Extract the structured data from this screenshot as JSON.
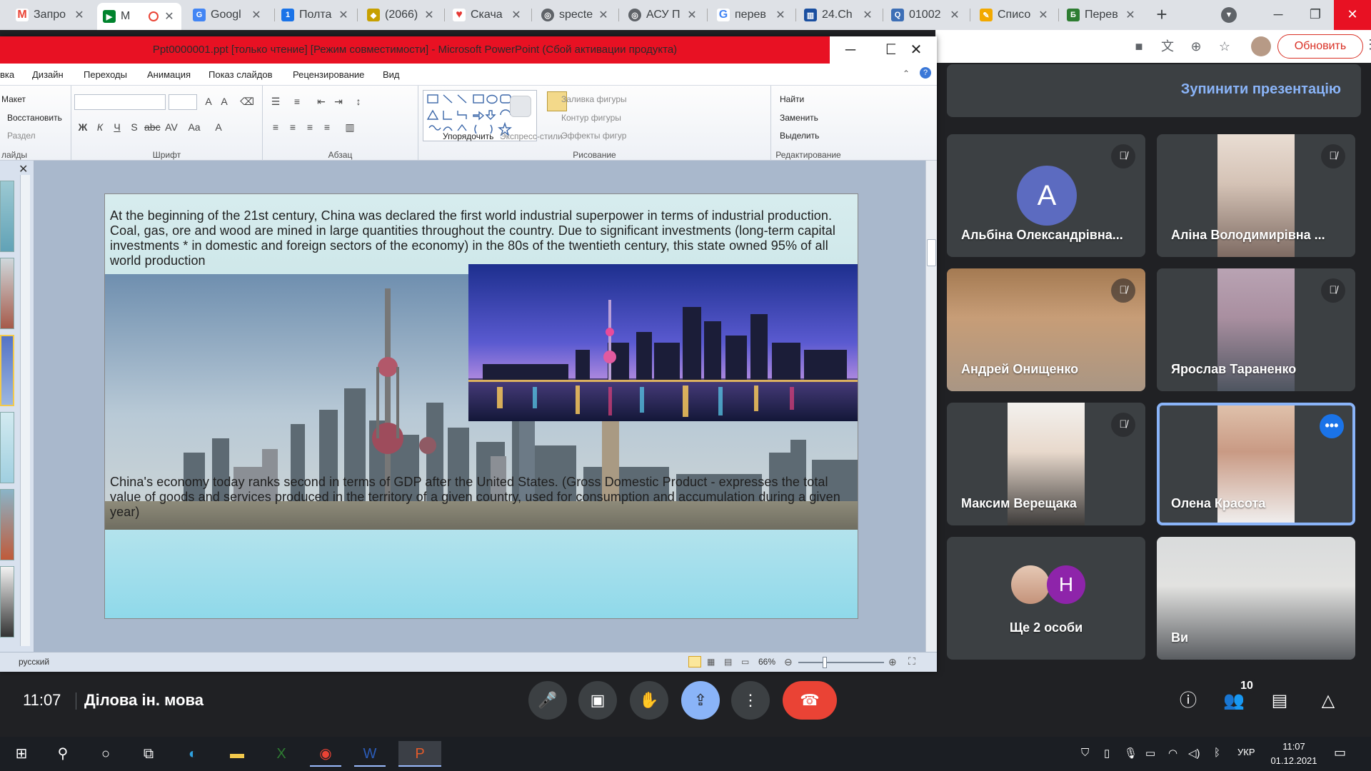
{
  "browser": {
    "tabs": [
      {
        "title": "Запро",
        "icon": "gmail-icon",
        "color": "#ea4335",
        "letter": "M"
      },
      {
        "title": "М",
        "icon": "meet-icon",
        "color": "#00832d",
        "letter": "▶"
      },
      {
        "title": "Googl",
        "icon": "google-translate-icon",
        "color": "#4285f4",
        "letter": "G"
      },
      {
        "title": "Полта",
        "icon": "calendar-icon",
        "color": "#1a73e8",
        "letter": "1"
      },
      {
        "title": "(2066)",
        "icon": "shop-icon",
        "color": "#c7a000",
        "letter": "◆"
      },
      {
        "title": "Скача",
        "icon": "heart-icon",
        "color": "#e53935",
        "letter": "♥"
      },
      {
        "title": "specte",
        "icon": "globe-icon",
        "color": "#5f6368",
        "letter": "◎"
      },
      {
        "title": "АСУ П",
        "icon": "globe-icon",
        "color": "#5f6368",
        "letter": "◎"
      },
      {
        "title": "перев",
        "icon": "google-icon",
        "color": "#4285f4",
        "letter": "G"
      },
      {
        "title": "24.Ch",
        "icon": "bank-icon",
        "color": "#1a4fa0",
        "letter": "▥"
      },
      {
        "title": "01002",
        "icon": "search-doc-icon",
        "color": "#3d6fb6",
        "letter": "Q"
      },
      {
        "title": "Списо",
        "icon": "pencil-icon",
        "color": "#f2a900",
        "letter": "✎"
      },
      {
        "title": "Перев",
        "icon": "b-icon",
        "color": "#2e7d32",
        "letter": "Б"
      }
    ],
    "update_label": "Обновить"
  },
  "meet": {
    "stop_presenting_label": "Зупинити презентацію",
    "participants": [
      {
        "name": "Альбіна Олександрівна...",
        "letter": "A",
        "muted": true
      },
      {
        "name": "Аліна Володимирівна ...",
        "muted": true
      },
      {
        "name": "Андрей Онищенко",
        "muted": true
      },
      {
        "name": "Ярослав Тараненко",
        "muted": true
      },
      {
        "name": "Максим Верещака",
        "muted": true
      },
      {
        "name": "Олена Красота",
        "speaking": true
      },
      {
        "name": "Ще 2 особи",
        "letter": "Н"
      },
      {
        "name": "Ви"
      }
    ],
    "time": "11:07",
    "meeting_title": "Ділова ін. мова",
    "people_count": "10"
  },
  "ppt": {
    "title": "Ppt0000001.ppt [только чтение] [Режим совместимости] - Microsoft PowerPoint (Сбой активации продукта)",
    "tabs": [
      "вка",
      "Дизайн",
      "Переходы",
      "Анимация",
      "Показ слайдов",
      "Рецензирование",
      "Вид"
    ],
    "ribbon": {
      "slides_group": {
        "layout": "Макет",
        "reset": "Восстановить",
        "section": "Раздел",
        "label": "лайды"
      },
      "font_group_label": "Шрифт",
      "paragraph_group_label": "Абзац",
      "drawing_group": {
        "arrange": "Упорядочить",
        "quick_styles": "Экспресс-стили",
        "fill": "Заливка фигуры",
        "outline": "Контур фигуры",
        "effects": "Эффекты фигур",
        "label": "Рисование"
      },
      "editing_group": {
        "find": "Найти",
        "replace": "Заменить",
        "select": "Выделить",
        "label": "Редактирование"
      }
    },
    "slide": {
      "text_top": "At the beginning  of the 21st century, China  was declared the first world industrial superpower in terms of industrial production. Coal, gas, ore and wood are mined in large quantities throughout  the country. Due to significant investments  (long-term capital investments  * in domestic and  foreign sectors of the economy) in the 80s of the twentieth century,  this state owned 95% of all world production",
      "text_bottom": "China's  economy today ranks second in  terms of GDP after the United  States. (Gross Domestic Product - expresses the total value  of goods and services produced in the territory of a given  country, used for consumption  and accumulation  during a given year)"
    },
    "status": {
      "language": "русский",
      "zoom": "66%"
    }
  },
  "taskbar": {
    "language": "УКР",
    "time": "11:07",
    "date": "01.12.2021"
  }
}
